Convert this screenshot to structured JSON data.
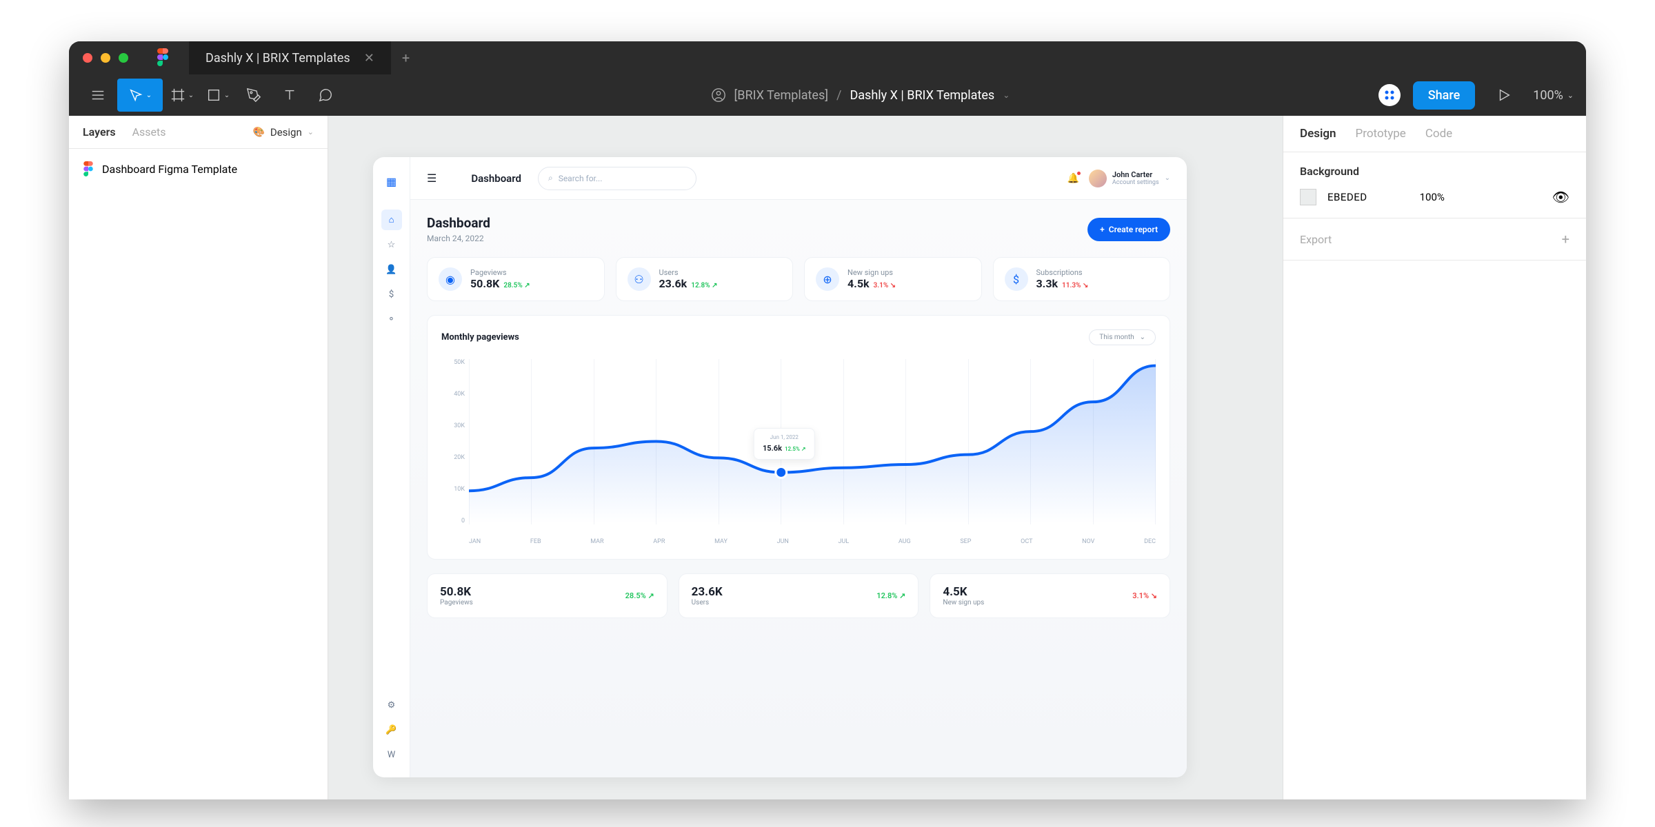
{
  "window": {
    "tab_title": "Dashly X | BRIX Templates"
  },
  "toolbar": {
    "owner": "[BRIX Templates]",
    "filename": "Dashly X | BRIX Templates",
    "share_label": "Share",
    "zoom": "100%"
  },
  "left_panel": {
    "tabs": {
      "layers": "Layers",
      "assets": "Assets"
    },
    "page": "Design",
    "root_layer": "Dashboard Figma Template"
  },
  "right_panel": {
    "tabs": {
      "design": "Design",
      "prototype": "Prototype",
      "code": "Code"
    },
    "background_label": "Background",
    "bg_color": "EBEDED",
    "bg_opacity": "100%",
    "export_label": "Export"
  },
  "dashboard": {
    "nav_header": "Dashboard",
    "search_placeholder": "Search for...",
    "user": {
      "name": "John Carter",
      "sub": "Account settings"
    },
    "page_title": "Dashboard",
    "date": "March 24, 2022",
    "create_report": "Create report",
    "stats": [
      {
        "label": "Pageviews",
        "value": "50.8K",
        "delta": "28.5%",
        "dir": "up"
      },
      {
        "label": "Users",
        "value": "23.6k",
        "delta": "12.8%",
        "dir": "up"
      },
      {
        "label": "New sign ups",
        "value": "4.5k",
        "delta": "3.1%",
        "dir": "down"
      },
      {
        "label": "Subscriptions",
        "value": "3.3k",
        "delta": "11.3%",
        "dir": "down"
      }
    ],
    "chart": {
      "title": "Monthly pageviews",
      "dropdown": "This month",
      "tooltip": {
        "date": "Jun 1, 2022",
        "value": "15.6k",
        "delta": "12.5%"
      }
    },
    "bottom_cards": [
      {
        "value": "50.8K",
        "label": "Pageviews",
        "delta": "28.5%",
        "dir": "up"
      },
      {
        "value": "23.6K",
        "label": "Users",
        "delta": "12.8%",
        "dir": "up"
      },
      {
        "value": "4.5K",
        "label": "New sign ups",
        "delta": "3.1%",
        "dir": "down"
      }
    ]
  },
  "chart_data": {
    "type": "line",
    "title": "Monthly pageviews",
    "ylabel": "",
    "ylim": [
      0,
      50
    ],
    "yticks": [
      "50K",
      "40K",
      "30K",
      "20K",
      "10K",
      "0"
    ],
    "categories": [
      "JAN",
      "FEB",
      "MAR",
      "APR",
      "MAY",
      "JUN",
      "JUL",
      "AUG",
      "SEP",
      "OCT",
      "NOV",
      "DEC"
    ],
    "values": [
      10,
      14,
      23,
      25,
      20,
      15.6,
      17,
      18,
      21,
      28,
      37,
      48
    ],
    "highlight": {
      "index": 5,
      "label": "Jun 1, 2022",
      "value": "15.6k",
      "delta": "12.5%"
    }
  }
}
